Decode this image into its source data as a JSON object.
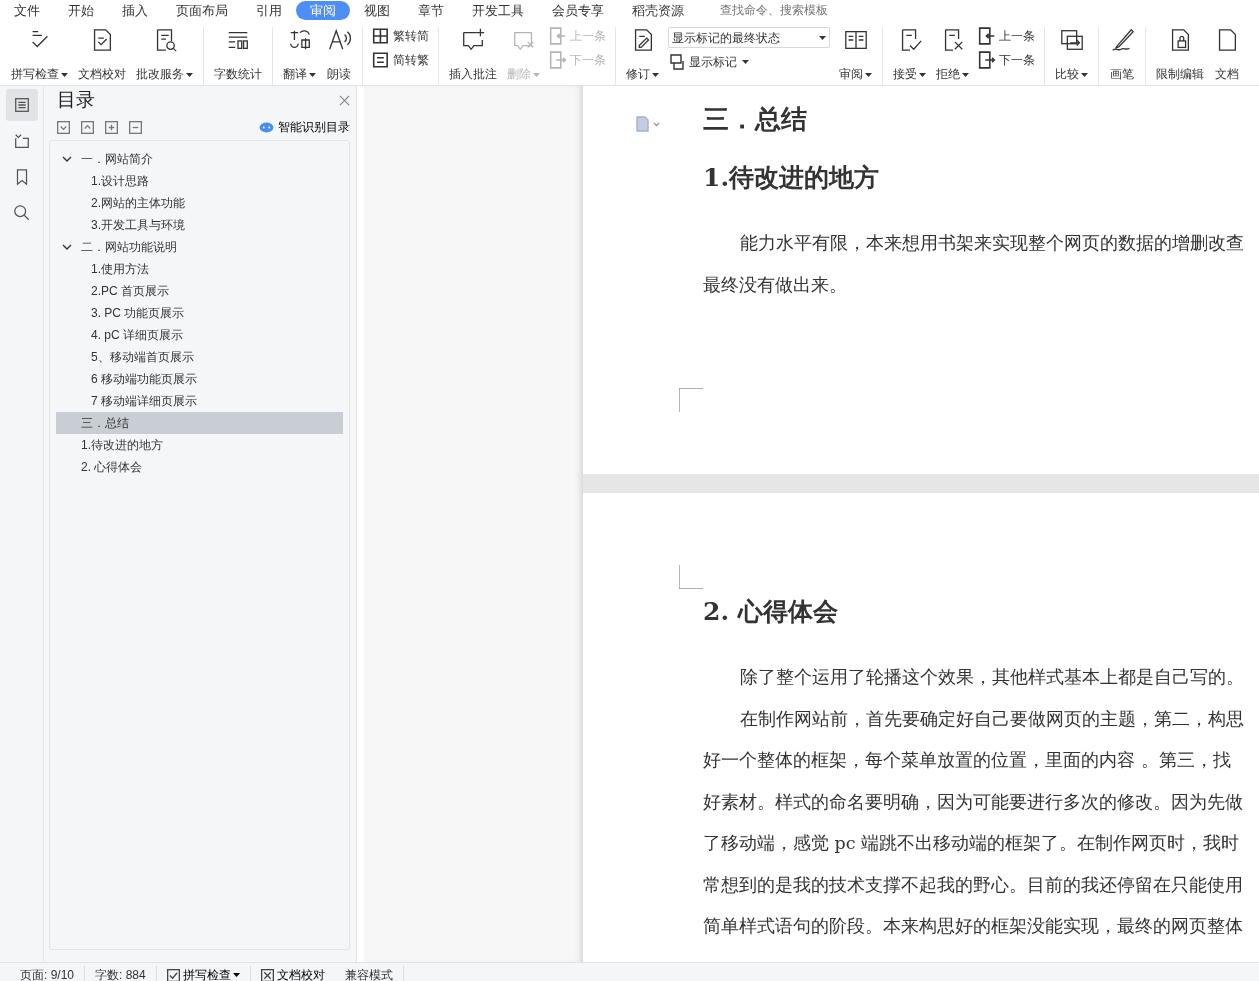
{
  "menu": {
    "app_menu": "文件",
    "tabs": [
      {
        "label": "开始",
        "selected": false
      },
      {
        "label": "插入",
        "selected": false
      },
      {
        "label": "页面布局",
        "selected": false
      },
      {
        "label": "引用",
        "selected": false
      },
      {
        "label": "审阅",
        "selected": true
      },
      {
        "label": "视图",
        "selected": false
      },
      {
        "label": "章节",
        "selected": false
      },
      {
        "label": "开发工具",
        "selected": false
      },
      {
        "label": "会员专享",
        "selected": false
      },
      {
        "label": "稻壳资源",
        "selected": false
      }
    ],
    "search": {
      "placeholder": "查找命令、搜索模板"
    }
  },
  "toolbar": [
    {
      "kind": "big",
      "label": "拼写检查",
      "dropdown": true,
      "disabled": false
    },
    {
      "kind": "big",
      "label": "文档校对",
      "dropdown": false,
      "disabled": false
    },
    {
      "kind": "big",
      "label": "批改服务",
      "dropdown": true,
      "disabled": false
    },
    {
      "kind": "separator"
    },
    {
      "kind": "big",
      "label": "字数统计",
      "dropdown": false,
      "disabled": false
    },
    {
      "kind": "separator"
    },
    {
      "kind": "big",
      "label": "翻译",
      "dropdown": true,
      "disabled": false
    },
    {
      "kind": "big",
      "label": "朗读",
      "dropdown": false,
      "disabled": false
    },
    {
      "kind": "separator"
    },
    {
      "kind": "stack",
      "items": [
        {
          "label": "繁转简",
          "disabled": false
        },
        {
          "label": "简转繁",
          "disabled": false
        }
      ]
    },
    {
      "kind": "separator"
    },
    {
      "kind": "big",
      "label": "插入批注",
      "dropdown": false,
      "disabled": false
    },
    {
      "kind": "big",
      "label": "删除",
      "dropdown": true,
      "disabled": true
    },
    {
      "kind": "stack",
      "items": [
        {
          "label": "上一条",
          "disabled": true
        },
        {
          "label": "下一条",
          "disabled": true
        }
      ]
    },
    {
      "kind": "separator"
    },
    {
      "kind": "big",
      "label": "修订",
      "dropdown": true,
      "disabled": false
    },
    {
      "kind": "select",
      "value": "显示标记的最终状态",
      "sub_label": "显示标记"
    },
    {
      "kind": "big",
      "label": "审阅",
      "dropdown": true,
      "disabled": false
    },
    {
      "kind": "separator"
    },
    {
      "kind": "big",
      "label": "接受",
      "dropdown": true,
      "disabled": false
    },
    {
      "kind": "big",
      "label": "拒绝",
      "dropdown": true,
      "disabled": false
    },
    {
      "kind": "stack",
      "items": [
        {
          "label": "上一条",
          "disabled": false
        },
        {
          "label": "下一条",
          "disabled": false
        }
      ]
    },
    {
      "kind": "separator"
    },
    {
      "kind": "big",
      "label": "比较",
      "dropdown": true,
      "disabled": false
    },
    {
      "kind": "separator"
    },
    {
      "kind": "big",
      "label": "画笔",
      "dropdown": false,
      "disabled": false
    },
    {
      "kind": "separator"
    },
    {
      "kind": "big",
      "label": "限制编辑",
      "dropdown": false,
      "disabled": false
    },
    {
      "kind": "big",
      "label": "文档",
      "dropdown": false,
      "disabled": false
    }
  ],
  "side_strip": [
    {
      "selected": true
    },
    {
      "selected": false
    },
    {
      "selected": false
    },
    {
      "selected": false
    }
  ],
  "toc_panel": {
    "title": "目录",
    "smart_button": "智能识别目录",
    "items": [
      {
        "label": "一．网站简介",
        "expanded": true,
        "selected": false,
        "children": [
          {
            "label": "1.设计思路",
            "selected": false
          },
          {
            "label": "2.网站的主体功能",
            "selected": false
          },
          {
            "label": "3.开发工具与环境",
            "selected": false
          }
        ]
      },
      {
        "label": "二．网站功能说明",
        "expanded": true,
        "selected": false,
        "children": [
          {
            "label": "1.使用方法",
            "selected": false
          },
          {
            "label": "2.PC 首页展示",
            "selected": false
          },
          {
            "label": "3. PC 功能页展示",
            "selected": false
          },
          {
            "label": "4. pC 详细页展示",
            "selected": false
          },
          {
            "label": "5、移动端首页展示",
            "selected": false
          },
          {
            "label": "6 移动端功能页展示",
            "selected": false
          },
          {
            "label": "7 移动端详细页展示",
            "selected": false
          }
        ]
      },
      {
        "label": "三．总结",
        "selected": true
      },
      {
        "label": "1.待改进的地方",
        "selected": false
      },
      {
        "label": "2. 心得体会",
        "selected": false
      }
    ]
  },
  "document": {
    "pages": [
      {
        "blocks": [
          {
            "kind": "title",
            "text": "三．总结"
          },
          {
            "kind": "heading",
            "text": "1.待改进的地方"
          },
          {
            "kind": "paragraph",
            "lines": [
              "能力水平有限，本来想用书架来实现整个网页的数据的增删改查",
              "最终没有做出来。"
            ]
          }
        ]
      },
      {
        "blocks": [
          {
            "kind": "heading",
            "text": "2.  心得体会"
          },
          {
            "kind": "paragraph",
            "lines": [
              "除了整个运用了轮播这个效果，其他样式基本上都是自己写的。"
            ]
          },
          {
            "kind": "paragraph",
            "lines": [
              "在制作网站前，首先要确定好自己要做网页的主题，第二，构思",
              "好一个整体的框架，每个菜单放置的位置，里面的内容 。第三，找",
              "好素材。样式的命名要明确，因为可能要进行多次的修改。因为先做",
              "了移动端，感觉 pc 端跳不出移动端的框架了。在制作网页时，我时",
              "常想到的是我的技术支撑不起我的野心。目前的我还停留在只能使用",
              "简单样式语句的阶段。本来构思好的框架没能实现，最终的网页整体"
            ]
          }
        ]
      }
    ]
  },
  "status_bar": {
    "page": "页面: 9/10",
    "words": "字数: 884",
    "spell_check": {
      "label": "拼写检查",
      "checked": true
    },
    "proofread": {
      "label": "文档校对"
    },
    "mode": "兼容模式"
  }
}
